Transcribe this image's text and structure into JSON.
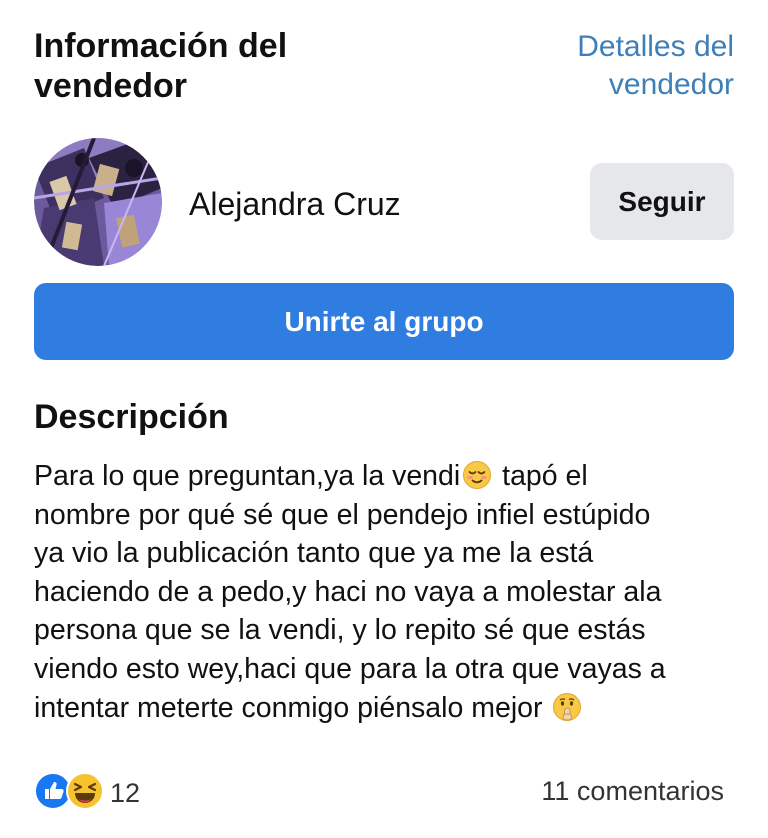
{
  "header": {
    "title": "Información del vendedor",
    "details_link": "Detalles del vendedor"
  },
  "seller": {
    "name": "Alejandra Cruz",
    "follow_label": "Seguir",
    "avatar_icon": "seller-avatar-photo"
  },
  "join_label": "Unirte al grupo",
  "description": {
    "heading": "Descripción",
    "lines": [
      {
        "text": "Para lo que preguntan,ya la vendi",
        "emoji": "relieved-face-icon",
        "after": " tapó el"
      },
      {
        "text": "nombre por qué sé que el pendejo infiel estúpido"
      },
      {
        "text": "ya vio la publicación tanto que ya me la está"
      },
      {
        "text": "haciendo de a pedo,y haci no vaya a molestar ala"
      },
      {
        "text": "persona que se la vendi, y lo repito sé que estás"
      },
      {
        "text": "viendo esto wey,haci que para la otra que vayas a"
      },
      {
        "text": "intentar meterte conmigo piénsalo mejor ",
        "emoji": "shushing-face-icon"
      }
    ]
  },
  "footer": {
    "reaction_icons": [
      "like-icon",
      "haha-icon"
    ],
    "reaction_count": "12",
    "comments": "11 comentarios"
  },
  "colors": {
    "link": "#3f7fb8",
    "primary_button": "#2f7de1",
    "secondary_button": "#e5e7eb"
  }
}
